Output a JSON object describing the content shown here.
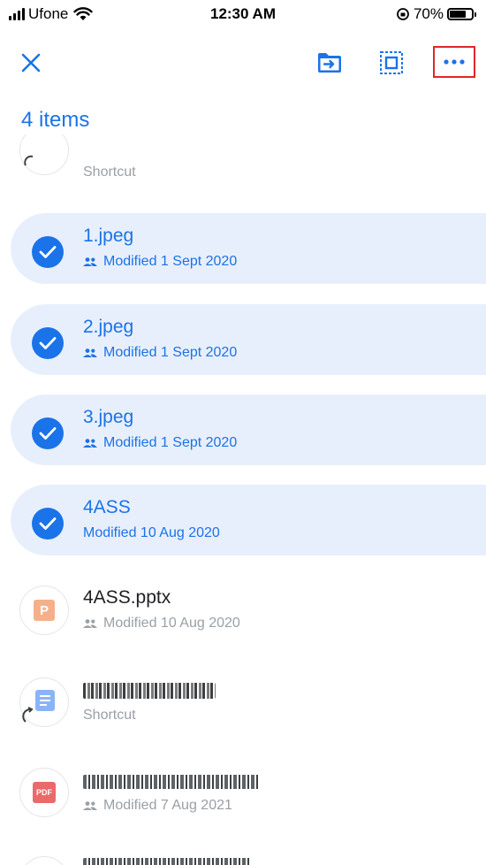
{
  "status_bar": {
    "carrier": "Ufone",
    "time": "12:30 AM",
    "battery": "70%"
  },
  "toolbar": {
    "icons": [
      "close-icon",
      "move-to-folder-icon",
      "select-all-icon",
      "more-options-icon"
    ]
  },
  "header": {
    "title": "4 items"
  },
  "items": [
    {
      "name": "",
      "subtitle": "Shortcut",
      "selected": false
    },
    {
      "name": "1.jpeg",
      "subtitle": "Modified 1 Sept 2020",
      "selected": true,
      "shared": true
    },
    {
      "name": "2.jpeg",
      "subtitle": "Modified 1 Sept 2020",
      "selected": true,
      "shared": true
    },
    {
      "name": "3.jpeg",
      "subtitle": "Modified 1 Sept 2020",
      "selected": true,
      "shared": true
    },
    {
      "name": "4ASS",
      "subtitle": "Modified 10 Aug 2020",
      "selected": true,
      "shared": false
    },
    {
      "name": "4ASS.pptx",
      "subtitle": "Modified 10 Aug 2020",
      "selected": false,
      "shared": true,
      "type_letter": "P"
    },
    {
      "name": "",
      "subtitle": "Shortcut",
      "selected": false
    },
    {
      "name": "",
      "subtitle": "Modified 7 Aug 2021",
      "selected": false,
      "shared": true,
      "type_label": "PDF"
    }
  ],
  "colors": {
    "accent": "#1a73e8",
    "selected_bg": "#e8effc",
    "highlight_box": "#e0262b"
  }
}
